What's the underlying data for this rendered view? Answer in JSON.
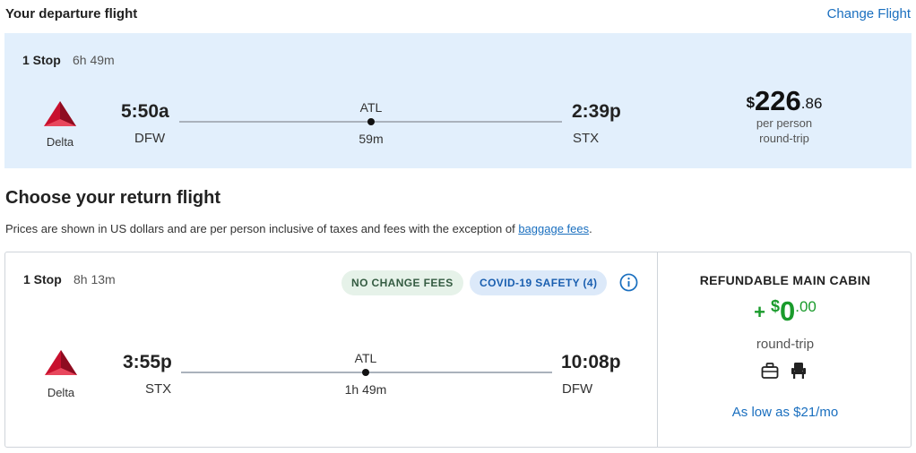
{
  "header": {
    "title": "Your departure flight",
    "change_link": "Change Flight"
  },
  "departure": {
    "stops": "1 Stop",
    "duration": "6h 49m",
    "airline": "Delta",
    "depart_time": "5:50a",
    "depart_airport": "DFW",
    "stop_airport": "ATL",
    "layover": "59m",
    "arrive_time": "2:39p",
    "arrive_airport": "STX",
    "price_symbol": "$",
    "price_whole": "226",
    "price_cents": ".86",
    "price_basis": "per person",
    "price_trip": "round-trip"
  },
  "return_section": {
    "title": "Choose your return flight",
    "disclaimer_prefix": "Prices are shown in US dollars and are per person inclusive of taxes and fees with the exception of ",
    "disclaimer_link": "baggage fees",
    "disclaimer_suffix": "."
  },
  "return_flight": {
    "stops": "1 Stop",
    "duration": "8h 13m",
    "badge_fees": "NO CHANGE FEES",
    "badge_covid": "COVID-19 SAFETY (4)",
    "airline": "Delta",
    "depart_time": "3:55p",
    "depart_airport": "STX",
    "stop_airport": "ATL",
    "layover": "1h 49m",
    "arrive_time": "10:08p",
    "arrive_airport": "DFW"
  },
  "fare": {
    "title": "REFUNDABLE MAIN CABIN",
    "plus": "+",
    "symbol": "$",
    "whole": "0",
    "cents": ".00",
    "trip": "round-trip",
    "icons": [
      "carry-on-bag-icon",
      "seat-icon"
    ],
    "monthly": "As low as $21/mo"
  },
  "colors": {
    "accent_link": "#1a6fbf",
    "card_bg": "#e2effc",
    "price_green": "#1a9b2c",
    "delta_red": "#c8102e"
  }
}
